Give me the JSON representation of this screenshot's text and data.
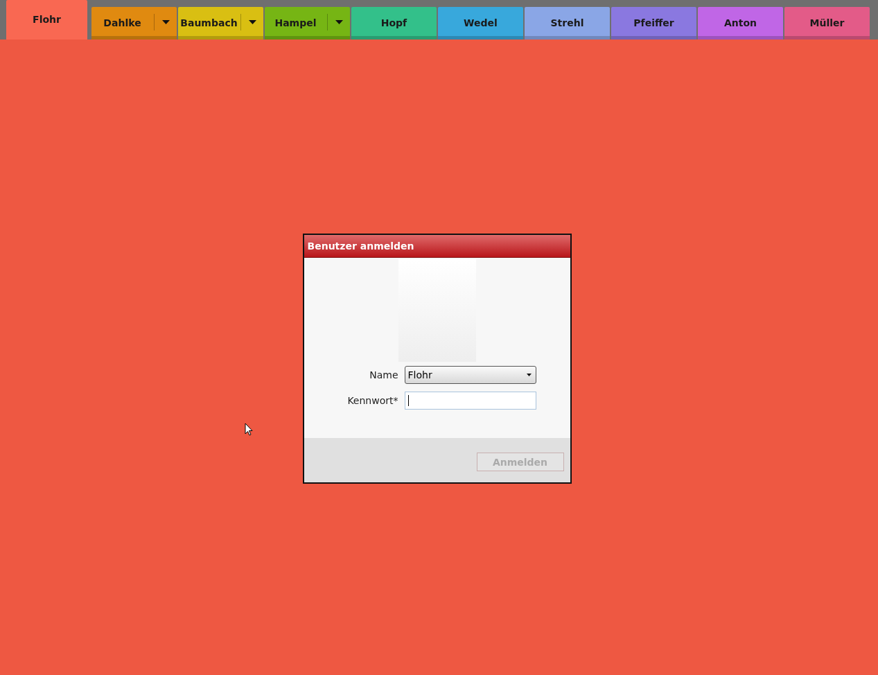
{
  "tabs": [
    {
      "label": "Flohr",
      "selected": true,
      "color": "#f26550",
      "has_dropdown": false
    },
    {
      "label": "Dahlke",
      "selected": false,
      "color": "#e08a10",
      "has_dropdown": true
    },
    {
      "label": "Baumbach",
      "selected": false,
      "color": "#d9bf12",
      "has_dropdown": true
    },
    {
      "label": "Hampel",
      "selected": false,
      "color": "#76b514",
      "has_dropdown": true
    },
    {
      "label": "Hopf",
      "selected": false,
      "color": "#33c08a",
      "has_dropdown": false
    },
    {
      "label": "Wedel",
      "selected": false,
      "color": "#38a8dc",
      "has_dropdown": false
    },
    {
      "label": "Strehl",
      "selected": false,
      "color": "#8aa6e6",
      "has_dropdown": false
    },
    {
      "label": "Pfeiffer",
      "selected": false,
      "color": "#8a78e0",
      "has_dropdown": false
    },
    {
      "label": "Anton",
      "selected": false,
      "color": "#c066e6",
      "has_dropdown": false
    },
    {
      "label": "Müller",
      "selected": false,
      "color": "#e35b88",
      "has_dropdown": false
    }
  ],
  "dialog": {
    "title": "Benutzer anmelden",
    "name_label": "Name",
    "name_value": "Flohr",
    "password_label": "Kennwort*",
    "login_button": {
      "label": "Anmelden",
      "disabled": true
    }
  }
}
